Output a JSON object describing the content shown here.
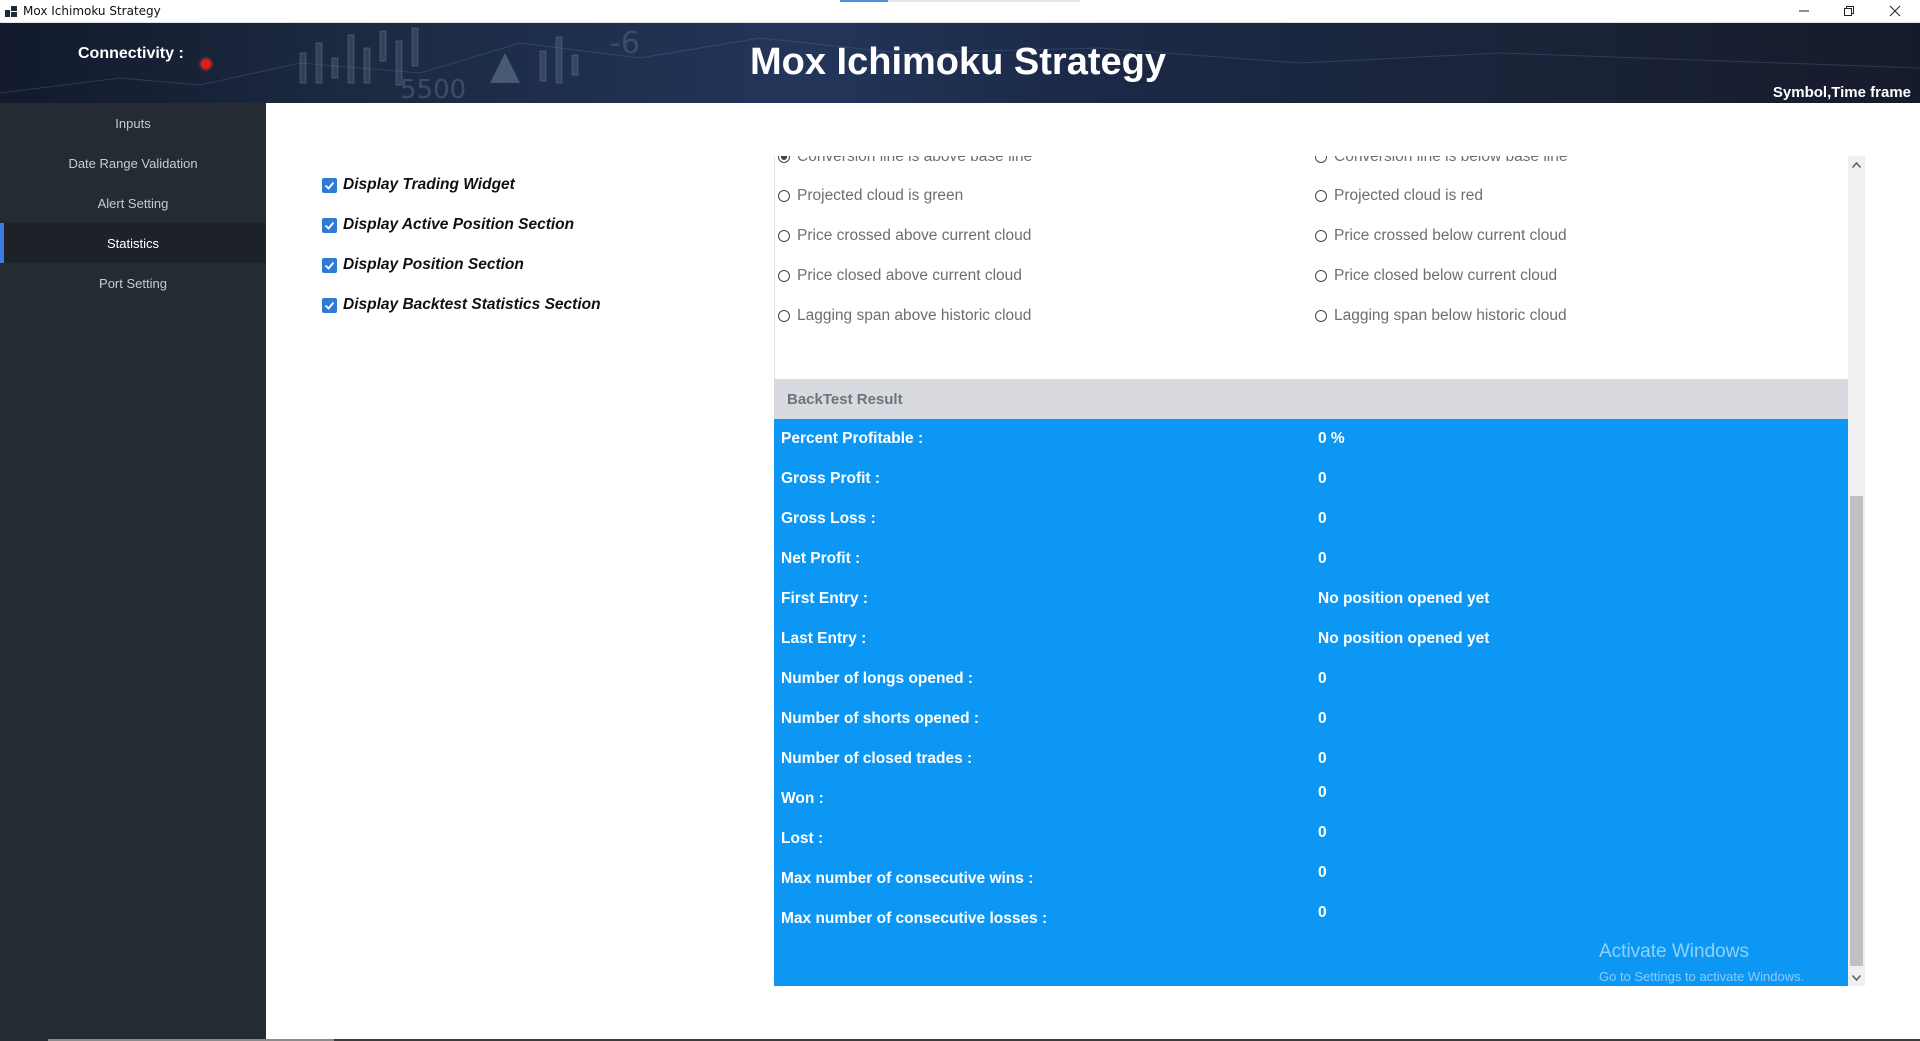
{
  "window": {
    "title": "Mox Ichimoku Strategy",
    "minimize_icon": "minimize-icon",
    "restore_icon": "restore-icon",
    "close_icon": "close-icon"
  },
  "header": {
    "connectivity_label": "Connectivity :",
    "connectivity_status_color": "#e01b1b",
    "title": "Mox Ichimoku Strategy",
    "symbol_timeframe": "Symbol,Time frame"
  },
  "sidebar": {
    "items": [
      {
        "label": "Inputs",
        "active": false
      },
      {
        "label": "Date Range Validation",
        "active": false
      },
      {
        "label": "Alert Setting",
        "active": false
      },
      {
        "label": "Statistics",
        "active": true
      },
      {
        "label": "Port Setting",
        "active": false
      }
    ]
  },
  "display_options": [
    {
      "label": "Display Trading Widget",
      "checked": true
    },
    {
      "label": "Display Active Position Section",
      "checked": true
    },
    {
      "label": "Display Position Section",
      "checked": true
    },
    {
      "label": "Display Backtest Statistics Section",
      "checked": true
    }
  ],
  "conditions": {
    "left": [
      {
        "label": "Conversion line is above base line",
        "selected": true
      },
      {
        "label": "Projected cloud is green",
        "selected": false
      },
      {
        "label": "Price crossed above current cloud",
        "selected": false
      },
      {
        "label": "Price closed above current cloud",
        "selected": false
      },
      {
        "label": "Lagging span above historic cloud",
        "selected": false
      }
    ],
    "right": [
      {
        "label": "Conversion line is below base line",
        "selected": false
      },
      {
        "label": "Projected cloud is red",
        "selected": false
      },
      {
        "label": "Price crossed below current cloud",
        "selected": false
      },
      {
        "label": "Price closed below current cloud",
        "selected": false
      },
      {
        "label": "Lagging span below historic cloud",
        "selected": false
      }
    ]
  },
  "backtest": {
    "title": "BackTest Result",
    "rows": [
      {
        "label": "Percent Profitable  :",
        "value": "0 %"
      },
      {
        "label": "Gross Profit :",
        "value": "0"
      },
      {
        "label": "Gross Loss :",
        "value": "0"
      },
      {
        "label": "Net Profit :",
        "value": "0"
      },
      {
        "label": "First Entry :",
        "value": "No position opened yet"
      },
      {
        "label": "Last Entry :",
        "value": "No position opened yet"
      },
      {
        "label": "Number of longs opened :",
        "value": "0"
      },
      {
        "label": "Number of shorts opened :",
        "value": "0"
      },
      {
        "label": "Number of closed trades :",
        "value": "0"
      },
      {
        "label": "Won :",
        "value": "0"
      },
      {
        "label": "Lost :",
        "value": "0"
      },
      {
        "label": "Max number of consecutive wins :",
        "value": "0"
      },
      {
        "label": "Max number of consecutive losses :",
        "value": "0"
      }
    ],
    "accent_color": "#0c97f5"
  },
  "watermark": {
    "line1": "Activate Windows",
    "line2": "Go to Settings to activate Windows."
  }
}
